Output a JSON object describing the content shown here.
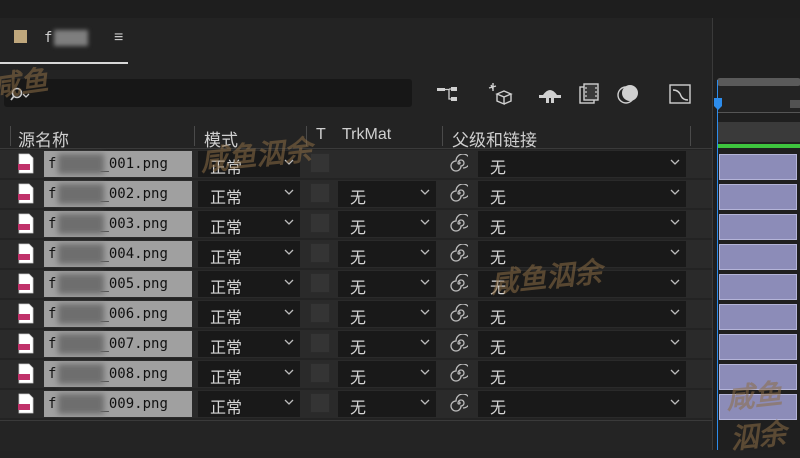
{
  "tab": {
    "title": "f"
  },
  "search": {
    "placeholder": ""
  },
  "columns": {
    "source_name": "源名称",
    "mode": "模式",
    "t": "T",
    "trkmat": "TrkMat",
    "parent": "父级和链接"
  },
  "rows": [
    {
      "name_prefix": "f",
      "name_suffix": "_001.png",
      "mode": "正常",
      "trkmat": "",
      "parent": "无"
    },
    {
      "name_prefix": "f",
      "name_suffix": "_002.png",
      "mode": "正常",
      "trkmat": "无",
      "parent": "无"
    },
    {
      "name_prefix": "f",
      "name_suffix": "_003.png",
      "mode": "正常",
      "trkmat": "无",
      "parent": "无"
    },
    {
      "name_prefix": "f",
      "name_suffix": "_004.png",
      "mode": "正常",
      "trkmat": "无",
      "parent": "无"
    },
    {
      "name_prefix": "f",
      "name_suffix": "_005.png",
      "mode": "正常",
      "trkmat": "无",
      "parent": "无"
    },
    {
      "name_prefix": "f",
      "name_suffix": "_006.png",
      "mode": "正常",
      "trkmat": "无",
      "parent": "无"
    },
    {
      "name_prefix": "f",
      "name_suffix": "_007.png",
      "mode": "正常",
      "trkmat": "无",
      "parent": "无"
    },
    {
      "name_prefix": "f",
      "name_suffix": "_008.png",
      "mode": "正常",
      "trkmat": "无",
      "parent": "无"
    },
    {
      "name_prefix": "f",
      "name_suffix": "_009.png",
      "mode": "正常",
      "trkmat": "无",
      "parent": "无"
    }
  ],
  "watermark": {
    "text_a": "咸鱼泅余",
    "text_b": "咸鱼泅余",
    "text_c": "咸鱼泅余",
    "text_d": "咸鱼"
  },
  "colors": {
    "accent": "#2d8ceb",
    "layer_bar": "#8c8cb8",
    "tab_swatch": "#bfa77c",
    "green_range": "#3ec43e"
  },
  "icons": [
    "search-icon",
    "menu-icon",
    "flowchart-icon",
    "draft-3d-icon",
    "shy-icon",
    "frame-blend-icon",
    "motion-blur-icon",
    "graph-editor-icon",
    "png-file-icon",
    "chevron-down-icon",
    "pick-whip-icon"
  ]
}
